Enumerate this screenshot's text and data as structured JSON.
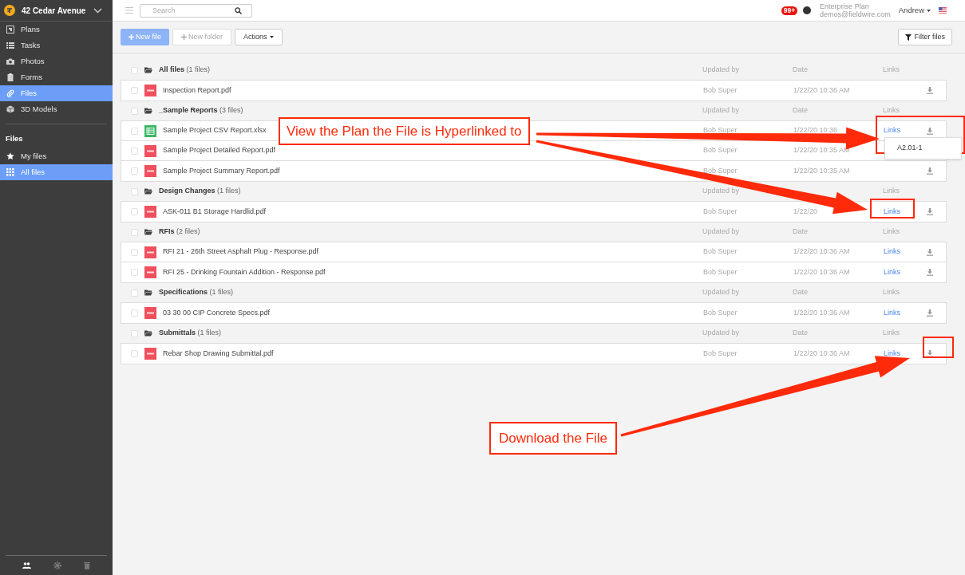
{
  "project": {
    "title": "42 Cedar Avenue"
  },
  "sidebar": {
    "items": [
      {
        "label": "Plans",
        "selected": false
      },
      {
        "label": "Tasks",
        "selected": false
      },
      {
        "label": "Photos",
        "selected": false
      },
      {
        "label": "Forms",
        "selected": false
      },
      {
        "label": "Files",
        "selected": true
      },
      {
        "label": "3D Models",
        "selected": false
      }
    ],
    "section_title": "Files",
    "section_items": [
      {
        "label": "My files",
        "selected": false
      },
      {
        "label": "All files",
        "selected": true
      }
    ]
  },
  "topbar": {
    "search": {
      "placeholder": "Search"
    },
    "notifications": "99+",
    "plan": "Enterprise Plan",
    "email": "demos@fieldwire.com",
    "user": "Andrew"
  },
  "toolbar": {
    "new_file": "New file",
    "new_folder": "New folder",
    "actions": "Actions",
    "filter": "Filter files"
  },
  "groups": [
    {
      "name": "All files",
      "count": "(1 files)",
      "checked": false,
      "columns": {
        "updated_by": "Updated by",
        "date": "Date",
        "links": "Links"
      },
      "files": [
        {
          "name": "Inspection Report.pdf",
          "kind": "pdf",
          "checked": false,
          "updated_by": "Bob Super",
          "date": "1/22/20 10:36 AM",
          "download": true
        }
      ]
    },
    {
      "name": "_Sample Reports",
      "count": "(3 files)",
      "checked": false,
      "columns": {
        "updated_by": "Updated by",
        "date": "Date",
        "links": "Links"
      },
      "files": [
        {
          "name": "Sample Project CSV Report.xlsx",
          "kind": "sheet",
          "checked": false,
          "updated_by": "Bob Super",
          "date": "1/22/20 10:36",
          "links": "Links",
          "link_menu": [
            "A2.01-1"
          ],
          "download": true
        },
        {
          "name": "Sample Project Detailed Report.pdf",
          "kind": "pdf",
          "checked": false,
          "updated_by": "Bob Super",
          "date": "1/22/20 10:35 AM",
          "download": false
        },
        {
          "name": "Sample Project Summary Report.pdf",
          "kind": "pdf",
          "checked": false,
          "updated_by": "Bob Super",
          "date": "1/22/20 10:35 AM",
          "download": true
        }
      ]
    },
    {
      "name": "Design Changes",
      "count": "(1 files)",
      "checked": false,
      "columns": {
        "updated_by": "Updated by",
        "links": "Links"
      },
      "files": [
        {
          "name": "ASK-011 B1 Storage Hardlid.pdf",
          "kind": "pdf",
          "checked": false,
          "updated_by": "Bob Super",
          "date": "1/22/20",
          "links": "Links",
          "download": true
        }
      ]
    },
    {
      "name": "RFIs",
      "count": "(2 files)",
      "checked": false,
      "columns": {
        "updated_by": "Updated by",
        "date": "Date",
        "links": "Links"
      },
      "files": [
        {
          "name": "RFI 21 - 26th Street Asphalt Plug - Response.pdf",
          "kind": "pdf",
          "checked": false,
          "updated_by": "Bob Super",
          "date": "1/22/20 10:36 AM",
          "links": "Links",
          "download": true
        },
        {
          "name": "RFI 25 - Drinking Fountain Addition - Response.pdf",
          "kind": "pdf",
          "checked": false,
          "updated_by": "Bob Super",
          "date": "1/22/20 10:36 AM",
          "links": "Links",
          "download": true
        }
      ]
    },
    {
      "name": "Specifications",
      "count": "(1 files)",
      "checked": false,
      "columns": {
        "updated_by": "Updated by",
        "date": "Date",
        "links": "Links"
      },
      "files": [
        {
          "name": "03 30 00 CIP Concrete Specs.pdf",
          "kind": "pdf",
          "checked": false,
          "updated_by": "Bob Super",
          "date": "1/22/20 10:36 AM",
          "links": "Links",
          "download": true
        }
      ]
    },
    {
      "name": "Submittals",
      "count": "(1 files)",
      "checked": false,
      "columns": {
        "updated_by": "Updated by",
        "date": "Date",
        "links": "Links"
      },
      "files": [
        {
          "name": "Rebar Shop Drawing Submittal.pdf",
          "kind": "pdf",
          "checked": false,
          "updated_by": "Bob Super",
          "date": "1/22/20 10:36 AM",
          "links": "Links",
          "download": true
        }
      ]
    }
  ],
  "annotations": [
    {
      "kind": "callout",
      "text": "View the Plan the File is Hyperlinked to"
    },
    {
      "kind": "callout",
      "text": "Download the File"
    }
  ]
}
